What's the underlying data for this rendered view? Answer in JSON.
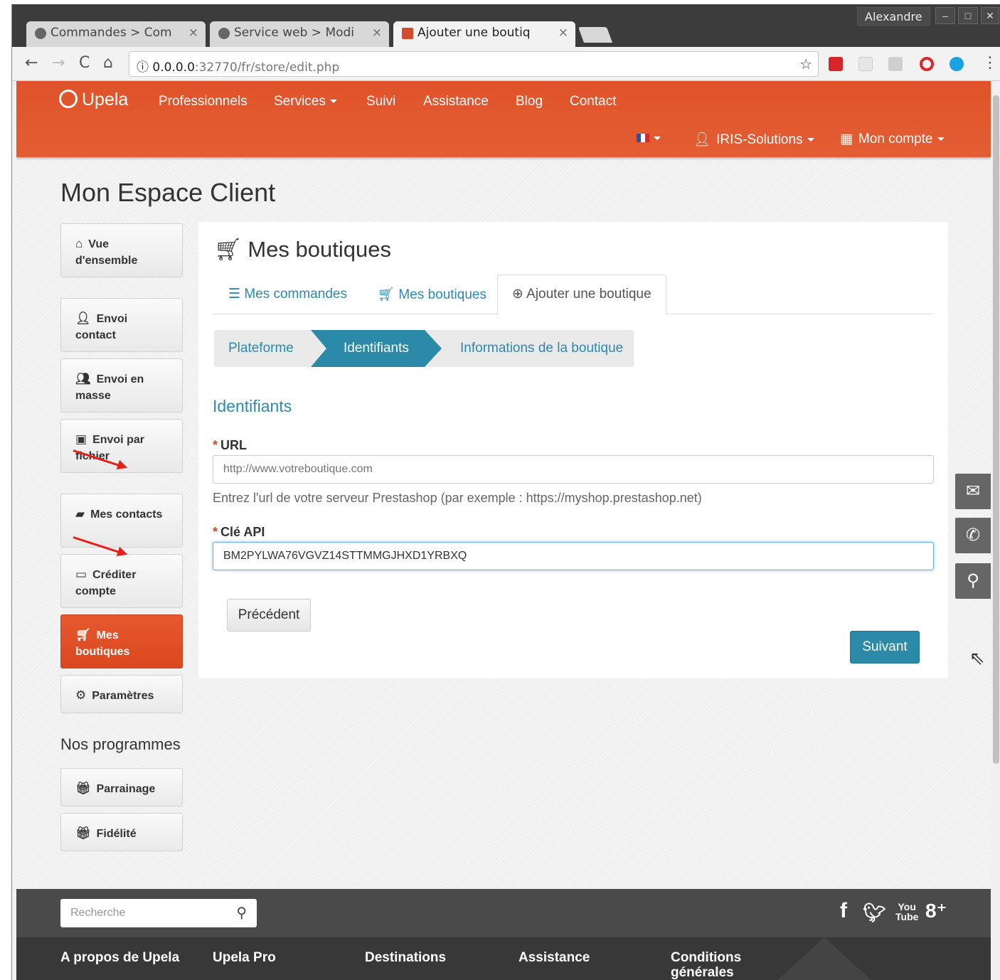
{
  "browser": {
    "tabs": [
      {
        "title": "Commandes > Com",
        "close": "×"
      },
      {
        "title": "Service web > Modi",
        "close": "×"
      },
      {
        "title": "Ajouter une boutiq",
        "close": "×"
      }
    ],
    "user": "Alexandre",
    "url_host": "0.0.0.0",
    "url_rest": ":32770/fr/store/edit.php",
    "nav": {
      "back": "←",
      "forward": "→",
      "reload": "C",
      "home": "⌂",
      "info": "ⓘ",
      "star": "☆",
      "menu": "⋮"
    }
  },
  "topnav": {
    "brand": "Upela",
    "menu": [
      "Professionnels",
      "Services",
      "Suivi",
      "Assistance",
      "Blog",
      "Contact"
    ],
    "account": "IRIS-Solutions",
    "my_account": "Mon compte"
  },
  "page": {
    "title": "Mon Espace Client"
  },
  "sidebar": {
    "items": [
      {
        "icon": "home-icon",
        "label": "Vue d'ensemble"
      },
      {
        "icon": "user-icon",
        "label": "Envoi contact"
      },
      {
        "icon": "users-icon",
        "label": "Envoi en masse"
      },
      {
        "icon": "save-icon",
        "label": "Envoi par fichier"
      },
      {
        "icon": "book-icon",
        "label": "Mes contacts"
      },
      {
        "icon": "credit-card-icon",
        "label": "Créditer compte"
      },
      {
        "icon": "cart-icon",
        "label": "Mes boutiques"
      },
      {
        "icon": "cogs-icon",
        "label": "Paramètres"
      }
    ],
    "programs_title": "Nos programmes",
    "programs": [
      {
        "icon": "gift-icon",
        "label": "Parrainage"
      },
      {
        "icon": "gift-icon",
        "label": "Fidélité"
      }
    ]
  },
  "main": {
    "title": "Mes boutiques",
    "tabs": [
      {
        "label": "Mes commandes"
      },
      {
        "label": "Mes boutiques"
      },
      {
        "label": "Ajouter une boutique"
      }
    ],
    "wizard": [
      "Plateforme",
      "Identifiants",
      "Informations de la boutique"
    ],
    "section": "Identifiants",
    "url_label": "URL",
    "url_placeholder": "http://www.votreboutique.com",
    "url_help": "Entrez l'url de votre serveur Prestashop (par exemple : https://myshop.prestashop.net)",
    "api_label": "Clé API",
    "api_value": "BM2PYLWA76VGVZ14STTMMGJHXD1YRBXQ",
    "required_mark": "*",
    "prev": "Précédent",
    "next": "Suivant"
  },
  "footer": {
    "search_placeholder": "Recherche",
    "columns": [
      "A propos de Upela",
      "Upela Pro",
      "Destinations",
      "Assistance",
      "Conditions générales"
    ]
  },
  "colors": {
    "brand_orange": "#e0532a",
    "accent_teal": "#2a8aa8",
    "link_blue": "#2a8ab0"
  }
}
